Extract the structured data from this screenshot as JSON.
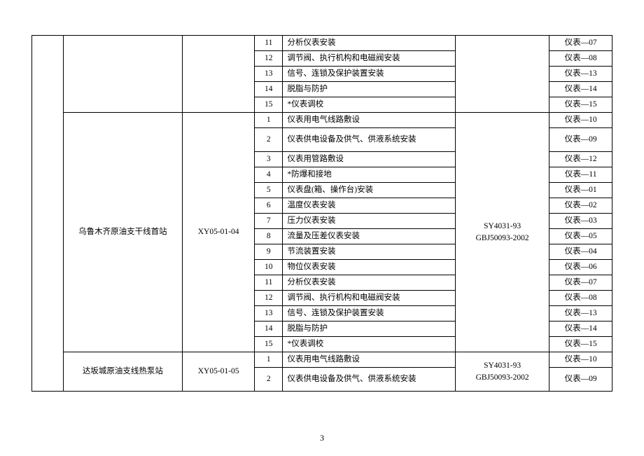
{
  "page_number": "3",
  "sections": [
    {
      "name": "",
      "code": "",
      "standard": "",
      "rows": [
        {
          "num": "11",
          "desc": "分析仪表安装",
          "ref": "仪表—07"
        },
        {
          "num": "12",
          "desc": "调节阀、执行机构和电磁阀安装",
          "ref": "仪表—08"
        },
        {
          "num": "13",
          "desc": "信号、连锁及保护装置安装",
          "ref": "仪表—13"
        },
        {
          "num": "14",
          "desc": "脱脂与防护",
          "ref": "仪表—14"
        },
        {
          "num": "15",
          "desc": "*仪表调校",
          "ref": "仪表—15"
        }
      ]
    },
    {
      "name": "乌鲁木齐原油支干线首站",
      "code": "XY05-01-04",
      "standard": "SY4031-93\nGBJ50093-2002",
      "rows": [
        {
          "num": "1",
          "desc": "仪表用电气线路敷设",
          "ref": "仪表—10"
        },
        {
          "num": "2",
          "desc": "仪表供电设备及供气、供液系统安装",
          "ref": "仪表—09",
          "tall": true
        },
        {
          "num": "3",
          "desc": "仪表用管路敷设",
          "ref": "仪表—12"
        },
        {
          "num": "4",
          "desc": "*防爆和接地",
          "ref": "仪表—11"
        },
        {
          "num": "5",
          "desc": "仪表盘(箱、操作台)安装",
          "ref": "仪表—01"
        },
        {
          "num": "6",
          "desc": "温度仪表安装",
          "ref": "仪表—02"
        },
        {
          "num": "7",
          "desc": "压力仪表安装",
          "ref": "仪表—03"
        },
        {
          "num": "8",
          "desc": "流量及压差仪表安装",
          "ref": "仪表—05"
        },
        {
          "num": "9",
          "desc": "节流装置安装",
          "ref": "仪表—04"
        },
        {
          "num": "10",
          "desc": "物位仪表安装",
          "ref": "仪表—06"
        },
        {
          "num": "11",
          "desc": "分析仪表安装",
          "ref": "仪表—07"
        },
        {
          "num": "12",
          "desc": "调节阀、执行机构和电磁阀安装",
          "ref": "仪表—08"
        },
        {
          "num": "13",
          "desc": "信号、连锁及保护装置安装",
          "ref": "仪表—13"
        },
        {
          "num": "14",
          "desc": "脱脂与防护",
          "ref": "仪表—14"
        },
        {
          "num": "15",
          "desc": "*仪表调校",
          "ref": "仪表—15"
        }
      ]
    },
    {
      "name": "达坂城原油支线热泵站",
      "code": "XY05-01-05",
      "standard": "SY4031-93\nGBJ50093-2002",
      "rows": [
        {
          "num": "1",
          "desc": "仪表用电气线路敷设",
          "ref": "仪表—10"
        },
        {
          "num": "2",
          "desc": "仪表供电设备及供气、供液系统安装",
          "ref": "仪表—09",
          "tall": true
        }
      ]
    }
  ]
}
